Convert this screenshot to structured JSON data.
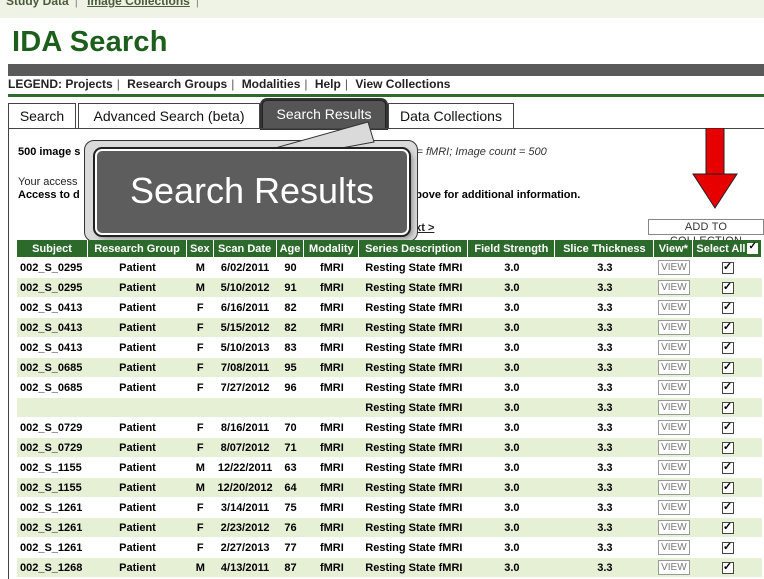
{
  "top_nav": {
    "items": [
      "Study Data",
      "Image Collections"
    ]
  },
  "page_title": "IDA Search",
  "legend": {
    "lead": "LEGEND:",
    "items": [
      "Projects",
      "Research Groups",
      "Modalities",
      "Help",
      "View Collections"
    ]
  },
  "tabs": [
    {
      "label": "Search",
      "active": false
    },
    {
      "label": "Advanced Search (beta)",
      "active": false
    },
    {
      "label": "Search Results",
      "active": true
    },
    {
      "label": "Data Collections",
      "active": false
    }
  ],
  "summary": {
    "count_text": "500 image s",
    "criteria_text": "lity = fMRI; Image count = 500",
    "access_line1": "Your access",
    "access_line2": "Access to d",
    "access_line3": "k above for additional information.",
    "next_label": "ext >"
  },
  "callout": {
    "text": "Search Results"
  },
  "add_to_collection_label": "ADD TO COLLECTION",
  "arrow_color": "#e60000",
  "table": {
    "headers": [
      "Subject",
      "Research Group",
      "Sex",
      "Scan Date",
      "Age",
      "Modality",
      "Series Description",
      "Field Strength",
      "Slice Thickness",
      "View*",
      "Select All"
    ],
    "view_label": "VIEW",
    "rows": [
      {
        "subject": "002_S_0295",
        "group": "Patient",
        "sex": "M",
        "date": "6/02/2011",
        "age": "90",
        "modality": "fMRI",
        "series": "Resting State fMRI",
        "field": "3.0",
        "slice": "3.3",
        "checked": true
      },
      {
        "subject": "002_S_0295",
        "group": "Patient",
        "sex": "M",
        "date": "5/10/2012",
        "age": "91",
        "modality": "fMRI",
        "series": "Resting State fMRI",
        "field": "3.0",
        "slice": "3.3",
        "checked": true
      },
      {
        "subject": "002_S_0413",
        "group": "Patient",
        "sex": "F",
        "date": "6/16/2011",
        "age": "82",
        "modality": "fMRI",
        "series": "Resting State fMRI",
        "field": "3.0",
        "slice": "3.3",
        "checked": true
      },
      {
        "subject": "002_S_0413",
        "group": "Patient",
        "sex": "F",
        "date": "5/15/2012",
        "age": "82",
        "modality": "fMRI",
        "series": "Resting State fMRI",
        "field": "3.0",
        "slice": "3.3",
        "checked": true
      },
      {
        "subject": "002_S_0413",
        "group": "Patient",
        "sex": "F",
        "date": "5/10/2013",
        "age": "83",
        "modality": "fMRI",
        "series": "Resting State fMRI",
        "field": "3.0",
        "slice": "3.3",
        "checked": true
      },
      {
        "subject": "002_S_0685",
        "group": "Patient",
        "sex": "F",
        "date": "7/08/2011",
        "age": "95",
        "modality": "fMRI",
        "series": "Resting State fMRI",
        "field": "3.0",
        "slice": "3.3",
        "checked": true
      },
      {
        "subject": "002_S_0685",
        "group": "Patient",
        "sex": "F",
        "date": "7/27/2012",
        "age": "96",
        "modality": "fMRI",
        "series": "Resting State fMRI",
        "field": "3.0",
        "slice": "3.3",
        "checked": true
      },
      {
        "subject": "",
        "group": "",
        "sex": "",
        "date": "",
        "age": "",
        "modality": "",
        "series": "Resting State fMRI",
        "field": "3.0",
        "slice": "3.3",
        "checked": true
      },
      {
        "subject": "002_S_0729",
        "group": "Patient",
        "sex": "F",
        "date": "8/16/2011",
        "age": "70",
        "modality": "fMRI",
        "series": "Resting State fMRI",
        "field": "3.0",
        "slice": "3.3",
        "checked": true
      },
      {
        "subject": "002_S_0729",
        "group": "Patient",
        "sex": "F",
        "date": "8/07/2012",
        "age": "71",
        "modality": "fMRI",
        "series": "Resting State fMRI",
        "field": "3.0",
        "slice": "3.3",
        "checked": true
      },
      {
        "subject": "002_S_1155",
        "group": "Patient",
        "sex": "M",
        "date": "12/22/2011",
        "age": "63",
        "modality": "fMRI",
        "series": "Resting State fMRI",
        "field": "3.0",
        "slice": "3.3",
        "checked": true
      },
      {
        "subject": "002_S_1155",
        "group": "Patient",
        "sex": "M",
        "date": "12/20/2012",
        "age": "64",
        "modality": "fMRI",
        "series": "Resting State fMRI",
        "field": "3.0",
        "slice": "3.3",
        "checked": true
      },
      {
        "subject": "002_S_1261",
        "group": "Patient",
        "sex": "F",
        "date": "3/14/2011",
        "age": "75",
        "modality": "fMRI",
        "series": "Resting State fMRI",
        "field": "3.0",
        "slice": "3.3",
        "checked": true
      },
      {
        "subject": "002_S_1261",
        "group": "Patient",
        "sex": "F",
        "date": "2/23/2012",
        "age": "76",
        "modality": "fMRI",
        "series": "Resting State fMRI",
        "field": "3.0",
        "slice": "3.3",
        "checked": true
      },
      {
        "subject": "002_S_1261",
        "group": "Patient",
        "sex": "F",
        "date": "2/27/2013",
        "age": "77",
        "modality": "fMRI",
        "series": "Resting State fMRI",
        "field": "3.0",
        "slice": "3.3",
        "checked": true
      },
      {
        "subject": "002_S_1268",
        "group": "Patient",
        "sex": "M",
        "date": "4/13/2011",
        "age": "87",
        "modality": "fMRI",
        "series": "Resting State fMRI",
        "field": "3.0",
        "slice": "3.3",
        "checked": true
      }
    ]
  }
}
